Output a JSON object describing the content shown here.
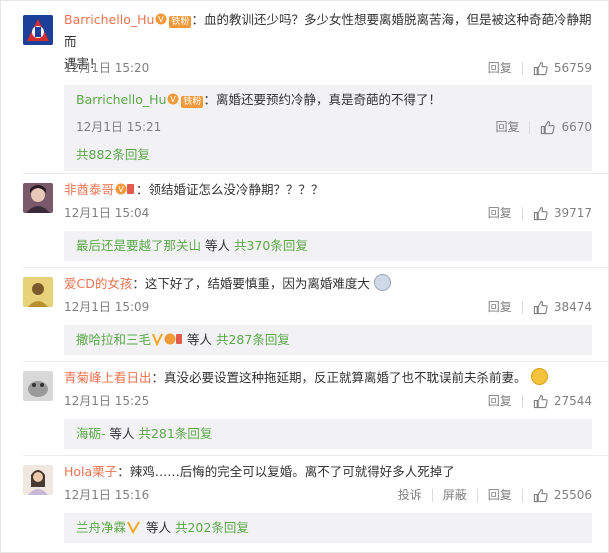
{
  "comments": [
    {
      "user": "Barrichello_Hu",
      "fan_badge": "铁粉",
      "text_line1": "：血的教训还少吗？多少女性想要离婚脱离苦海，但是被这种奇葩冷静期而",
      "text_line2": "遇害！",
      "time": "12月1日 15:20",
      "reply_label": "回复",
      "likes": "56759",
      "sub_reply": {
        "user": "Barrichello_Hu",
        "fan_badge": "铁粉",
        "text": "：离婚还要预约冷静，真是奇葩的不得了！",
        "time": "12月1日 15:21",
        "reply_label": "回复",
        "likes": "6670",
        "more": "共882条回复"
      }
    },
    {
      "user": "非酋泰哥",
      "text": "：领结婚证怎么没冷静期？？？？",
      "time": "12月1日 15:04",
      "reply_label": "回复",
      "likes": "39717",
      "more_who": "最后还是要越了那关山",
      "more_tail": " 等人 ",
      "more_count": "共370条回复"
    },
    {
      "user": "爱CD的女孩",
      "text": "：这下好了，结婚要慎重，因为离婚难度大",
      "time": "12月1日 15:09",
      "reply_label": "回复",
      "likes": "38474",
      "more_who": "撒哈拉和三毛",
      "more_tail": " 等人 ",
      "more_count": "共287条回复"
    },
    {
      "user": "青菊峰上看日出",
      "text": "：真没必要设置这种拖延期，反正就算离婚了也不耽误前夫杀前妻。",
      "time": "12月1日 15:25",
      "reply_label": "回复",
      "likes": "27544",
      "more_who": "海砺-",
      "more_tail": " 等人 ",
      "more_count": "共281条回复"
    },
    {
      "user": "Hola栗子",
      "text": "：辣鸡……后悔的完全可以复婚。离不了可就得好多人死掉了",
      "time": "12月1日 15:16",
      "report_label": "投诉",
      "block_label": "屏蔽",
      "reply_label": "回复",
      "likes": "25506",
      "more_who": "兰舟净霖",
      "more_tail": " 等人 ",
      "more_count": "共202条回复"
    }
  ],
  "colors": {
    "username": "#eb7350",
    "link_green": "#5ba84a",
    "meta_gray": "#808080",
    "reply_bg": "#f2f2f5"
  }
}
